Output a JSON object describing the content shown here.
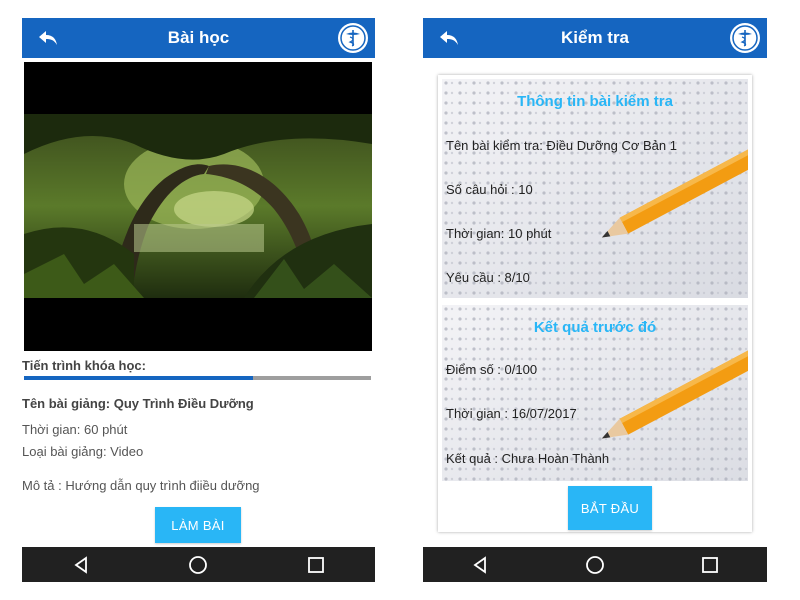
{
  "left_screen": {
    "header": {
      "title": "Bài học"
    },
    "progress": {
      "label": "Tiến trình khóa học:",
      "fraction": 0.66
    },
    "lesson": {
      "name": "Tên bài giảng: Quy Trình Điều Dưỡng",
      "duration": "Thời gian: 60 phút",
      "type": "Loại bài giảng: Video",
      "description": "Mô tả : Hướng dẫn quy trình điiều dưỡng"
    },
    "action_button": "LÀM BÀI"
  },
  "right_screen": {
    "header": {
      "title": "Kiểm tra"
    },
    "info_panel": {
      "title": "Thông tin bài kiểm tra",
      "test_name": "Tên bài kiểm tra: Điều Dưỡng Cơ Bản 1",
      "question_count": "Số câu hỏi : 10",
      "time": "Thời gian: 10 phút",
      "requirement": "Yêu cầu : 8/10"
    },
    "result_panel": {
      "title": "Kết quả trước đó",
      "score": "Điểm số : 0/100",
      "time": "Thời gian : 16/07/2017",
      "result": "Kết quả : Chưa Hoàn Thành"
    },
    "action_button": "BẮT ĐẦU"
  },
  "icons": {
    "back": "arrow-back-icon",
    "logo": "caduceus-logo-icon",
    "nav_back": "triangle-back-icon",
    "nav_home": "circle-home-icon",
    "nav_recent": "square-recent-icon"
  },
  "colors": {
    "app_bar": "#1565c0",
    "accent": "#29b6f6",
    "nav_bar": "#212121",
    "progress_track": "#9e9e9e"
  }
}
